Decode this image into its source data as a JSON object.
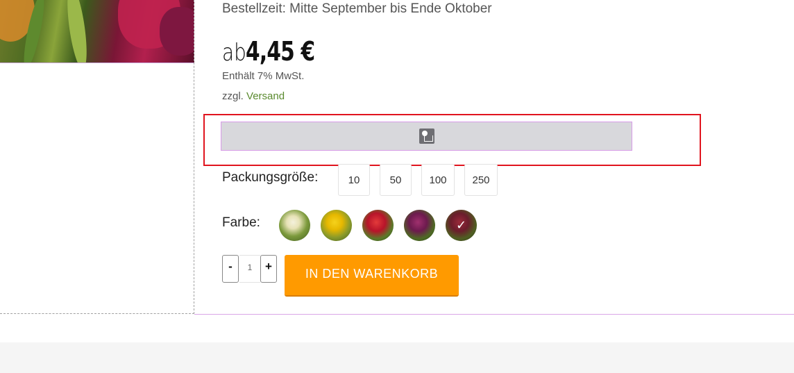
{
  "product": {
    "order_time": "Bestellzeit: Mitte September bis Ende Oktober",
    "price_prefix": "ab",
    "price_amount": "4,45 €",
    "vat_note": "Enthält 7% MwSt.",
    "shipping_prefix": "zzgl.",
    "shipping_link": "Versand"
  },
  "variant_image": {
    "icon": "image-placeholder-icon"
  },
  "package_size": {
    "label": "Packungsgröße:",
    "options": [
      "10",
      "50",
      "100",
      "250"
    ]
  },
  "color": {
    "label": "Farbe:",
    "swatches": [
      {
        "name": "white-tulips",
        "selected": false
      },
      {
        "name": "yellow-tulips",
        "selected": false
      },
      {
        "name": "red-tulips",
        "selected": false
      },
      {
        "name": "purple-tulips",
        "selected": false
      },
      {
        "name": "mixed-tulips",
        "selected": true
      }
    ],
    "check_glyph": "✓"
  },
  "quantity": {
    "minus": "-",
    "value": "1",
    "plus": "+"
  },
  "cart": {
    "button_label": "IN DEN WARENKORB",
    "accent_color": "#ff9a00"
  },
  "colors": {
    "link_green": "#5a8a2e",
    "highlight_red": "#e0141e"
  }
}
